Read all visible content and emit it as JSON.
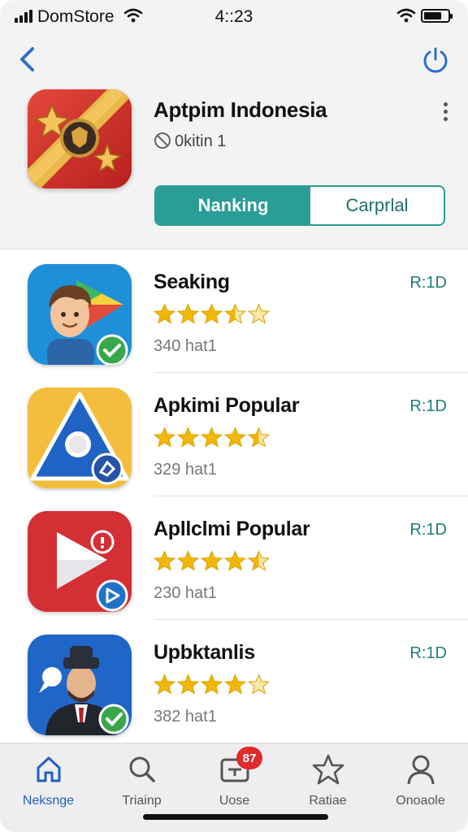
{
  "status_bar": {
    "carrier": "DomStore",
    "time": "4::23",
    "battery_level": 0.75
  },
  "header": {
    "app_title": "Aptpim Indonesia",
    "subtitle": "0kitin 1",
    "segments": {
      "active": "Nanking",
      "inactive": "Carprlal"
    },
    "icons": [
      "back-arrow-icon",
      "power-icon",
      "more-vertical-icon",
      "ban-icon"
    ]
  },
  "colors": {
    "accent": "#2a9d96",
    "tag": "#1d7d77",
    "star": "#f2b705",
    "active_tab": "#1f5fbf",
    "badge": "#e02b2b"
  },
  "list": [
    {
      "title": "Seaking",
      "tag": "R:1D",
      "rating": 3.5,
      "meta": "340 hat1"
    },
    {
      "title": "Apkimi Popular",
      "tag": "R:1D",
      "rating": 4.5,
      "meta": "329 hat1"
    },
    {
      "title": "Apllclmi Popular",
      "tag": "R:1D",
      "rating": 4.5,
      "meta": "230 hat1"
    },
    {
      "title": "Upbktanlis",
      "tag": "R:1D",
      "rating": 4,
      "meta": "382 hat1"
    }
  ],
  "tabs": [
    {
      "label": "Neksnge",
      "icon": "home-icon",
      "active": true
    },
    {
      "label": "Triainp",
      "icon": "search-icon"
    },
    {
      "label": "Uose",
      "icon": "inbox-icon",
      "badge": "87"
    },
    {
      "label": "Ratiae",
      "icon": "star-icon"
    },
    {
      "label": "Onoaole",
      "icon": "person-icon"
    }
  ]
}
